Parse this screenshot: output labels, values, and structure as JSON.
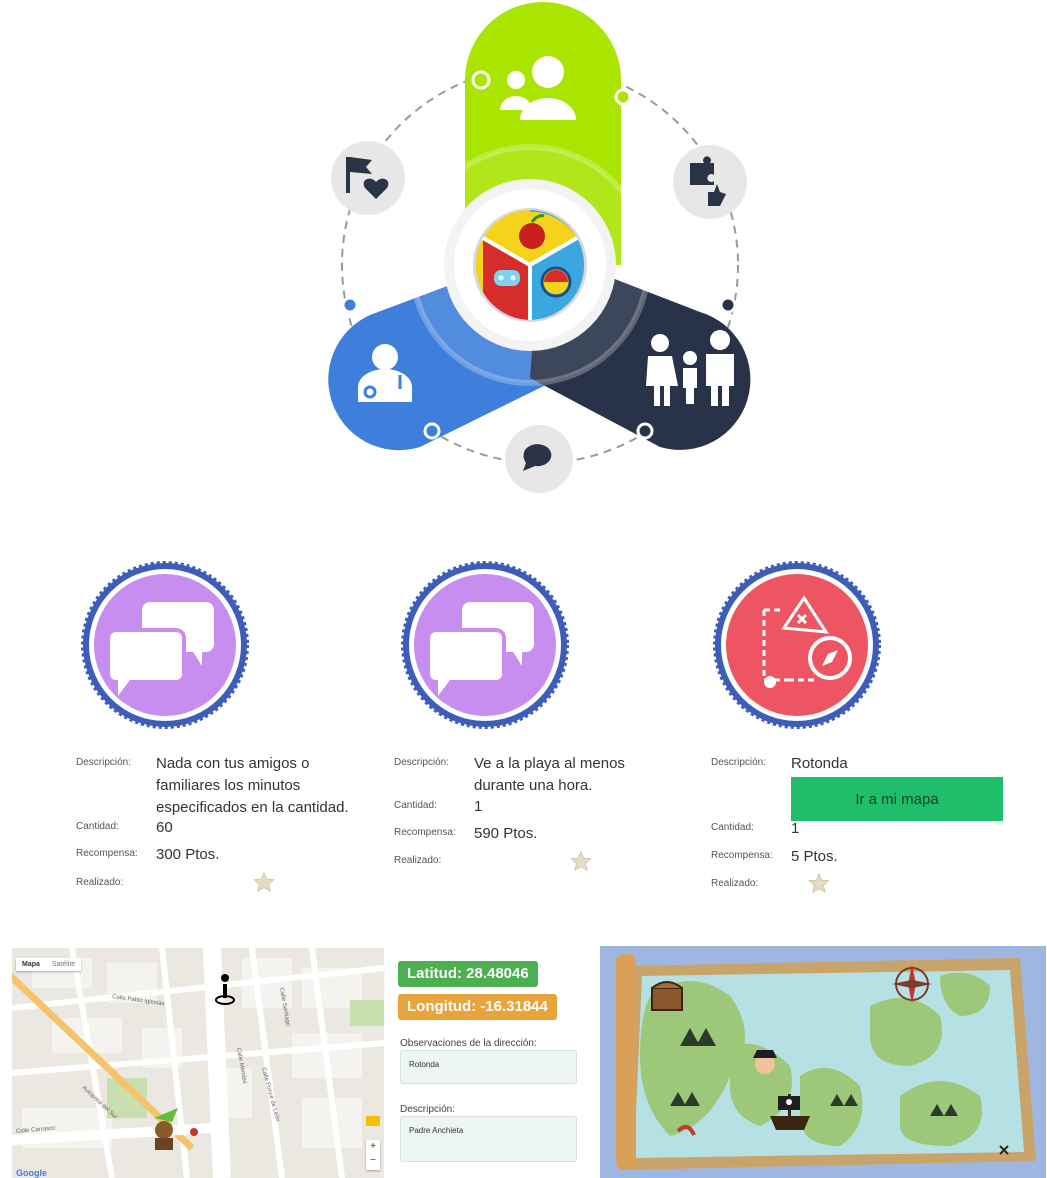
{
  "colors": {
    "green_arm": "#a9e500",
    "blue_arm": "#3e7fdb",
    "navy_arm": "#28334a",
    "icon_circle": "#e7e7e7",
    "badge_border": "#3d5db8",
    "badge_purple": "#c78ef0",
    "badge_red": "#ec5561",
    "button_green": "#1ebe6a",
    "lat_green": "#4caf50",
    "lng_orange": "#e8a33a"
  },
  "hero": {
    "icons": [
      "users-icon",
      "flag-heart-icon",
      "puzzle-like-icon",
      "doctor-icon",
      "family-icon",
      "chat-icon",
      "center-logo-icon"
    ]
  },
  "labels": {
    "descripcion": "Descripción:",
    "cantidad": "Cantidad:",
    "recompensa": "Recompensa:",
    "realizado": "Realizado:"
  },
  "challenges": [
    {
      "badge_icon": "chat-bubbles-icon",
      "descripcion": "Nada con tus amigos o familiares los minutos especificados en la cantidad.",
      "cantidad": "60",
      "recompensa": "300 Ptos."
    },
    {
      "badge_icon": "chat-bubbles-icon",
      "descripcion": "Ve a la playa al menos durante una hora.",
      "cantidad": "1",
      "recompensa": "590 Ptos."
    },
    {
      "badge_icon": "treasure-map-compass-icon",
      "descripcion": "Rotonda",
      "button": "Ir a mi mapa",
      "cantidad": "1",
      "recompensa": "5 Ptos."
    }
  ],
  "map": {
    "tabs": [
      "Mapa",
      "Satélite"
    ],
    "streets": [
      "Calle Pablo Iglesias",
      "Autopista del Sur",
      "Calle Carrasco",
      "Calle Santiago",
      "Calle Méndez",
      "Calle Ponce de León"
    ],
    "footer": "Google"
  },
  "location": {
    "latitud": "Latitud: 28.48046",
    "longitud": "Longitud: -16.31844",
    "obs_label": "Observaciones de la dirección:",
    "obs_value": "Rotonda",
    "desc_label": "Descripción:",
    "desc_value": "Padre Anchieta"
  }
}
